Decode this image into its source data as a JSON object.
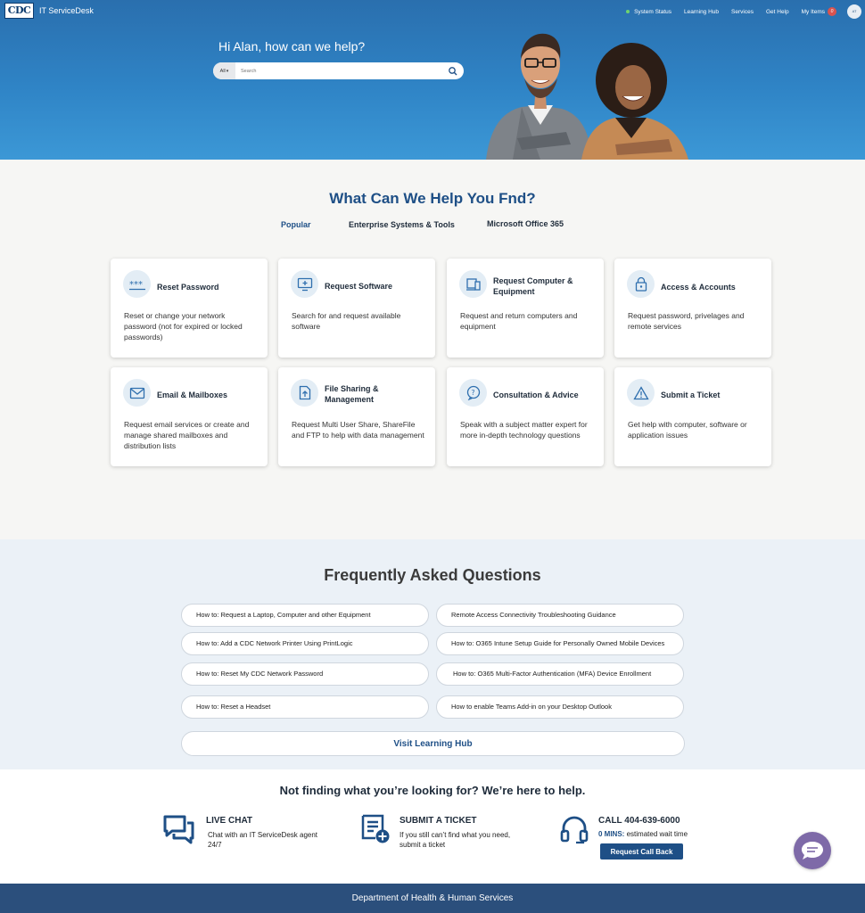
{
  "header": {
    "logo_text": "CDC",
    "app_title": "IT ServiceDesk",
    "nav": {
      "system_status": "System Status",
      "learning_hub": "Learning Hub",
      "services": "Services",
      "get_help": "Get Help",
      "my_items": "My Items",
      "my_items_count": "0"
    },
    "avatar_initials": "AT"
  },
  "hero": {
    "greeting": "Hi Alan, how can we help?",
    "search_scope": "All",
    "search_placeholder": "Search"
  },
  "help": {
    "title": "What Can We Help You Fnd?",
    "tabs": [
      "Popular",
      "Enterprise Systems & Tools",
      "Microsoft Office 365"
    ],
    "cards": [
      {
        "title": "Reset Password",
        "desc": "Reset or change your network password (not for expired or locked passwords)",
        "icon": "password-icon"
      },
      {
        "title": "Request Software",
        "desc": "Search for and request available software",
        "icon": "monitor-plus-icon"
      },
      {
        "title": "Request Computer & Equipment",
        "desc": "Request and return computers and equipment",
        "icon": "devices-icon"
      },
      {
        "title": "Access & Accounts",
        "desc": "Request password, privelages and remote services",
        "icon": "lock-icon"
      },
      {
        "title": "Email & Mailboxes",
        "desc": "Request email services or create and manage shared mailboxes and distribution lists",
        "icon": "envelope-icon"
      },
      {
        "title": "File Sharing & Management",
        "desc": "Request Multi User Share, ShareFile and FTP to help with data management",
        "icon": "file-upload-icon"
      },
      {
        "title": "Consultation & Advice",
        "desc": "Speak with a subject matter expert for more in-depth technology questions",
        "icon": "question-bubble-icon"
      },
      {
        "title": "Submit a Ticket",
        "desc": "Get help with computer, software or application issues",
        "icon": "warning-icon"
      }
    ]
  },
  "faq": {
    "title": "Frequently Asked Questions",
    "items": [
      "How to: Request a Laptop, Computer and other Equipment",
      "Remote Access Connectivity Troubleshooting Guidance",
      "How to: Add a CDC Network Printer Using PrintLogic",
      "How to: O365 Intune Setup Guide for Personally Owned Mobile Devices",
      "How to: Reset My CDC Network Password",
      "How to: O365 Multi-Factor Authentication (MFA) Device Enrollment",
      "How to: Reset a Headset",
      "How to enable Teams Add-in on your Desktop Outlook"
    ],
    "learning_hub_label": "Visit Learning Hub"
  },
  "contact": {
    "title": "Not finding what you’re looking for? We’re here to help.",
    "live_chat": {
      "head": "LIVE CHAT",
      "text": "Chat with an IT ServiceDesk agent 24/7"
    },
    "ticket": {
      "head": "SUBMIT A TICKET",
      "text": "If you still can’t find what you need, submit a ticket"
    },
    "call": {
      "head": "CALL 404-639-6000",
      "mins": "0 MINS:",
      "text": "estimated wait time",
      "button": "Request Call Back"
    }
  },
  "footer": {
    "text": "Department of Health & Human Services"
  },
  "colors": {
    "primary": "#1e4f86",
    "hero_blue": "#2f84c6",
    "footer": "#2b4f7c",
    "chat": "#7e6aa8"
  }
}
